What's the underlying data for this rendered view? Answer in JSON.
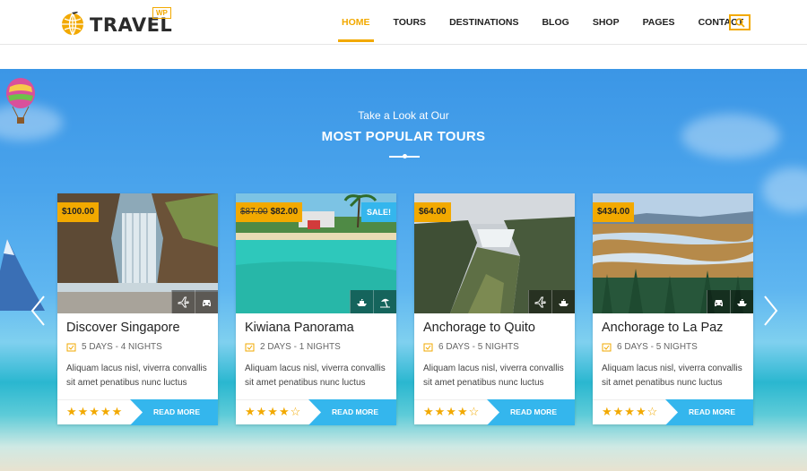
{
  "brand": {
    "name": "TRAVEL",
    "badge": "WP"
  },
  "nav": {
    "items": [
      {
        "label": "HOME",
        "active": true
      },
      {
        "label": "TOURS",
        "active": false
      },
      {
        "label": "DESTINATIONS",
        "active": false
      },
      {
        "label": "BLOG",
        "active": false
      },
      {
        "label": "SHOP",
        "active": false
      },
      {
        "label": "PAGES",
        "active": false
      },
      {
        "label": "CONTACT",
        "active": false
      }
    ],
    "search_icon": "search-icon"
  },
  "hero": {
    "kicker": "Take a Look at Our",
    "title": "MOST POPULAR TOURS"
  },
  "colors": {
    "accent": "#f2a900",
    "primary": "#34b6ed"
  },
  "tours": [
    {
      "price": "$100.00",
      "old_price": "",
      "sale": "",
      "title": "Discover Singapore",
      "duration": "5 DAYS - 4 NIGHTS",
      "desc": "Aliquam lacus nisl, viverra convallis sit amet penatibus nunc luctus",
      "rating": 5,
      "icons": [
        "plane-icon",
        "car-icon"
      ],
      "cta": "READ MORE"
    },
    {
      "price": "$82.00",
      "old_price": "$87.00",
      "sale": "SALE!",
      "title": "Kiwiana Panorama",
      "duration": "2 DAYS - 1 NIGHTS",
      "desc": "Aliquam lacus nisl, viverra convallis sit amet penatibus nunc luctus",
      "rating": 4,
      "icons": [
        "ship-icon",
        "beach-icon"
      ],
      "cta": "READ MORE"
    },
    {
      "price": "$64.00",
      "old_price": "",
      "sale": "",
      "title": "Anchorage to Quito",
      "duration": "6 DAYS - 5 NIGHTS",
      "desc": "Aliquam lacus nisl, viverra convallis sit amet penatibus nunc luctus",
      "rating": 4,
      "icons": [
        "plane-icon",
        "ship-icon"
      ],
      "cta": "READ MORE"
    },
    {
      "price": "$434.00",
      "old_price": "",
      "sale": "",
      "title": "Anchorage to La Paz",
      "duration": "6 DAYS - 5 NIGHTS",
      "desc": "Aliquam lacus nisl, viverra convallis sit amet penatibus nunc luctus",
      "rating": 4,
      "icons": [
        "car-icon",
        "ship-icon"
      ],
      "cta": "READ MORE"
    }
  ]
}
